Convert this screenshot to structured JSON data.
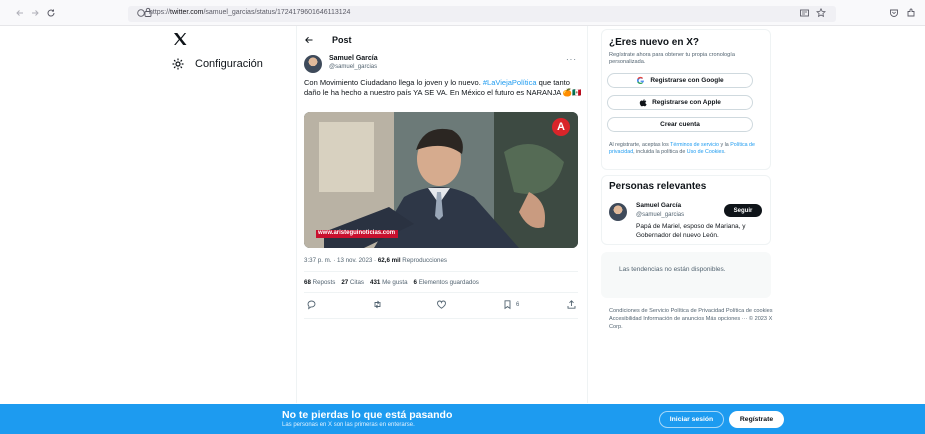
{
  "browser": {
    "url_prefix": "https://",
    "url_domain": "twitter.com",
    "url_path": "/samuel_garcias/status/1724179601646113124"
  },
  "nav": {
    "settings_label": "Configuración"
  },
  "post": {
    "header_title": "Post",
    "author_name": "Samuel García",
    "author_handle": "@samuel_garcias",
    "text_before": "Con Movimiento Ciudadano llega lo joven y lo nuevo. ",
    "hashtag": "#LaViejaPolítica",
    "text_after": " que tanto daño le ha hecho a nuestro país YA SE VA. En México el futuro es NARANJA 🍊🇲🇽",
    "media_watermark": "www.aristeguinoticias.com",
    "time": "3:37 p. m. · 13 nov. 2023 · ",
    "views_count": "62,6 mil",
    "views_label": " Reproducciones",
    "reposts_count": "68",
    "reposts_label": " Reposts",
    "quotes_count": "27",
    "quotes_label": " Citas",
    "likes_count": "431",
    "likes_label": " Me gusta",
    "bookmarks_count": "6",
    "bookmarks_label": " Elementos guardados",
    "bookmark_action_count": "6"
  },
  "signup": {
    "title": "¿Eres nuevo en X?",
    "subtitle": "Regístrate ahora para obtener tu propia cronología personalizada.",
    "google_label": "Registrarse con Google",
    "apple_label": "Registrarse con Apple",
    "create_label": "Crear cuenta",
    "legal_1": "Al registrarte, aceptas los ",
    "legal_terms": "Términos de servicio",
    "legal_2": " y la ",
    "legal_privacy": "Política de privacidad",
    "legal_3": ", incluida la política de ",
    "legal_cookies": "Uso de Cookies",
    "legal_4": "."
  },
  "relevant": {
    "title": "Personas relevantes",
    "name": "Samuel García",
    "handle": "@samuel_garcias",
    "follow_label": "Seguir",
    "bio": "Papá de Mariel, esposo de Mariana, y Gobernador del nuevo León."
  },
  "trends": {
    "message": "Las tendencias no están disponibles."
  },
  "footer": {
    "links": "Condiciones de Servicio  Política de Privacidad  Política de cookies  Accesibilidad  Información de anuncios  Más opciones ···  © 2023 X Corp."
  },
  "banner": {
    "title": "No te pierdas lo que está pasando",
    "subtitle": "Las personas en X son las primeras en enterarse.",
    "login_label": "Iniciar sesión",
    "register_label": "Regístrate"
  },
  "colors": {
    "accent": "#1d9bf0",
    "text": "#0f1419",
    "muted": "#536471"
  }
}
